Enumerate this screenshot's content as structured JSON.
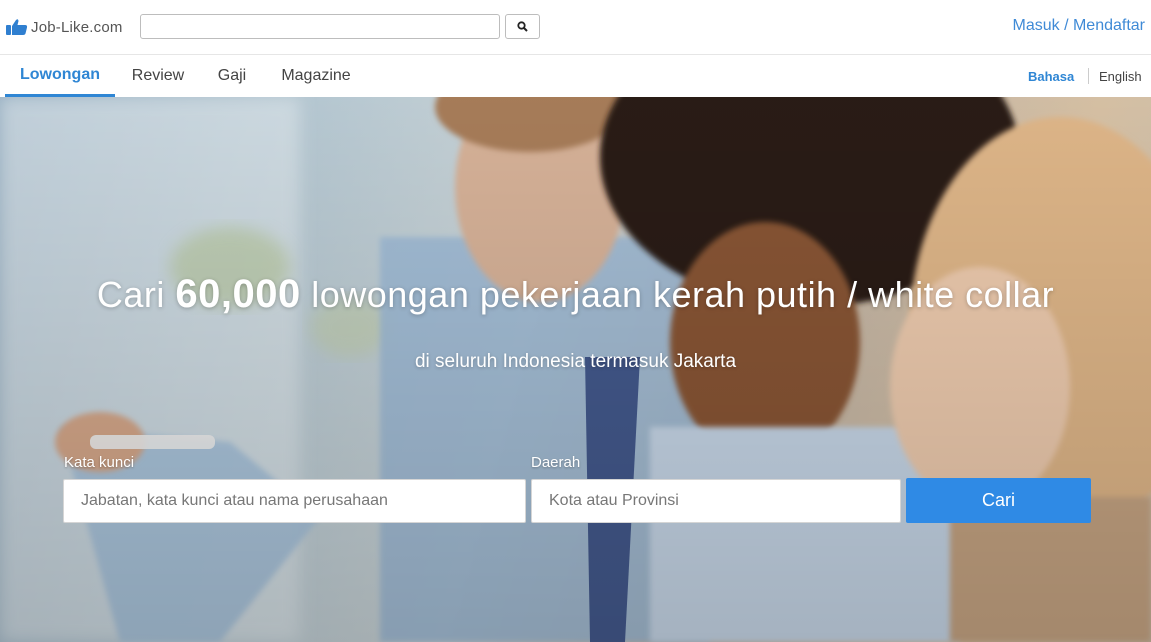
{
  "header": {
    "logo_text": "Job-Like.com",
    "search": {
      "value": "",
      "placeholder": ""
    },
    "search_icon": "search-icon",
    "auth_link": "Masuk / Mendaftar"
  },
  "nav": {
    "tabs": [
      {
        "label": "Lowongan",
        "active": true
      },
      {
        "label": "Review",
        "active": false
      },
      {
        "label": "Gaji",
        "active": false
      },
      {
        "label": "Magazine",
        "active": false
      }
    ],
    "languages": [
      {
        "label": "Bahasa",
        "active": true
      },
      {
        "label": "English",
        "active": false
      }
    ]
  },
  "hero": {
    "title_prefix": "Cari",
    "title_number": "60,000",
    "title_suffix": "lowongan pekerjaan kerah putih / white collar",
    "subtitle": "di seluruh Indonesia termasuk Jakarta",
    "keyword_label": "Kata kunci",
    "keyword_placeholder": "Jabatan, kata kunci atau nama perusahaan",
    "keyword_value": "",
    "region_label": "Daerah",
    "region_placeholder": "Kota atau Provinsi",
    "region_value": "",
    "submit_label": "Cari"
  },
  "colors": {
    "accent": "#2f86d4",
    "button": "#2f8ae5",
    "link": "#3f8ad6"
  }
}
